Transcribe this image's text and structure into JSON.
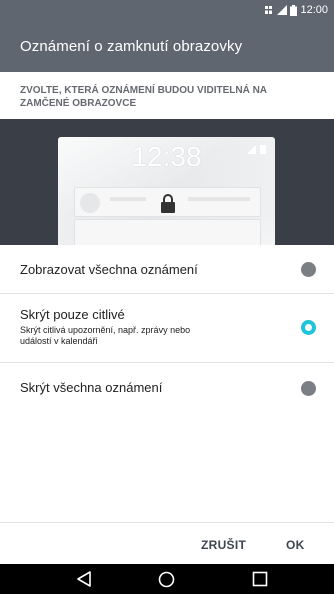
{
  "status": {
    "time": "12:00"
  },
  "header": {
    "title": "Oznámení o zamknutí obrazovky"
  },
  "section": {
    "subtitle_line1": "ZVOLTE, KTERÁ OZNÁMENÍ BUDOU VIDITELNÁ NA",
    "subtitle_line2": "ZAMČENÉ OBRAZOVCE"
  },
  "preview": {
    "clock": "12:38"
  },
  "options": [
    {
      "label": "Zobrazovat všechna oznámení",
      "selected": false
    },
    {
      "label": "Skrýt pouze citlivé",
      "description_line1": "Skrýt citlivá upozornění, např. zprávy nebo",
      "description_line2": "událostí v kalendáři",
      "selected": true
    },
    {
      "label": "Skrýt všechna oznámení",
      "selected": false
    }
  ],
  "dialog": {
    "cancel_label": "ZRUŠIT",
    "ok_label": "OK"
  },
  "colors": {
    "header": "#5f6670",
    "preview_bg": "#3a3f47",
    "accent": "#1ec3dc"
  }
}
